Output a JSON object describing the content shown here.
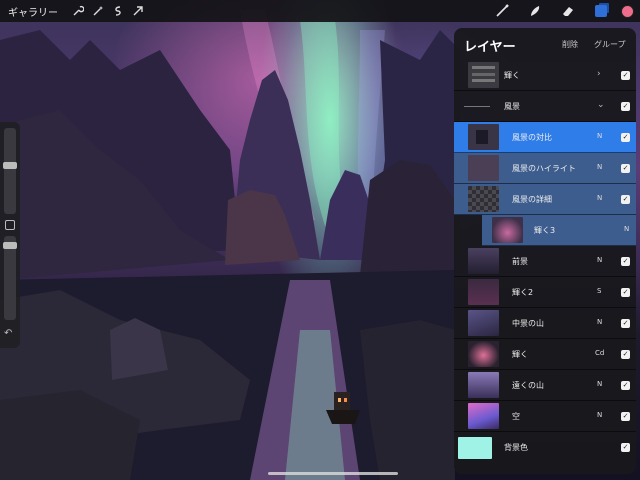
{
  "toolbar": {
    "gallery_label": "ギャラリー",
    "left_icons": [
      "wrench-icon",
      "magic-wand-icon",
      "selection-icon",
      "transform-arrow-icon"
    ],
    "right_icons": [
      "brush-icon",
      "smudge-icon",
      "eraser-icon",
      "layers-icon",
      "color-swatch"
    ],
    "current_color": "#ef6d8c"
  },
  "sidebar": {
    "size_slider_level": 0.18,
    "opacity_slider_level": 0.2
  },
  "layers_panel": {
    "title": "レイヤー",
    "delete_label": "削除",
    "group_label": "グループ",
    "accent_color": "#2e7de8",
    "layers": [
      {
        "name": "輝く",
        "blend": "",
        "group": false,
        "expanded": false,
        "checked": true
      },
      {
        "name": "風景",
        "blend": "",
        "group": true,
        "expanded": true,
        "checked": true
      },
      {
        "name": "風景の対比",
        "blend": "N",
        "checked": true,
        "selected": "primary"
      },
      {
        "name": "風景のハイライト",
        "blend": "N",
        "checked": true,
        "selected": "secondary"
      },
      {
        "name": "風景の詳細",
        "blend": "N",
        "checked": true,
        "selected": "secondary"
      },
      {
        "name": "輝く3",
        "blend": "N",
        "checked": false,
        "selected": "secondary"
      },
      {
        "name": "前景",
        "blend": "N",
        "checked": true
      },
      {
        "name": "輝く2",
        "blend": "S",
        "checked": true
      },
      {
        "name": "中景の山",
        "blend": "N",
        "checked": true
      },
      {
        "name": "輝く",
        "blend": "Cd",
        "checked": true
      },
      {
        "name": "遠くの山",
        "blend": "N",
        "checked": true
      },
      {
        "name": "空",
        "blend": "N",
        "checked": true
      },
      {
        "name": "背景色",
        "blend": "",
        "checked": true,
        "background_color": "#9ef3e6"
      }
    ]
  }
}
